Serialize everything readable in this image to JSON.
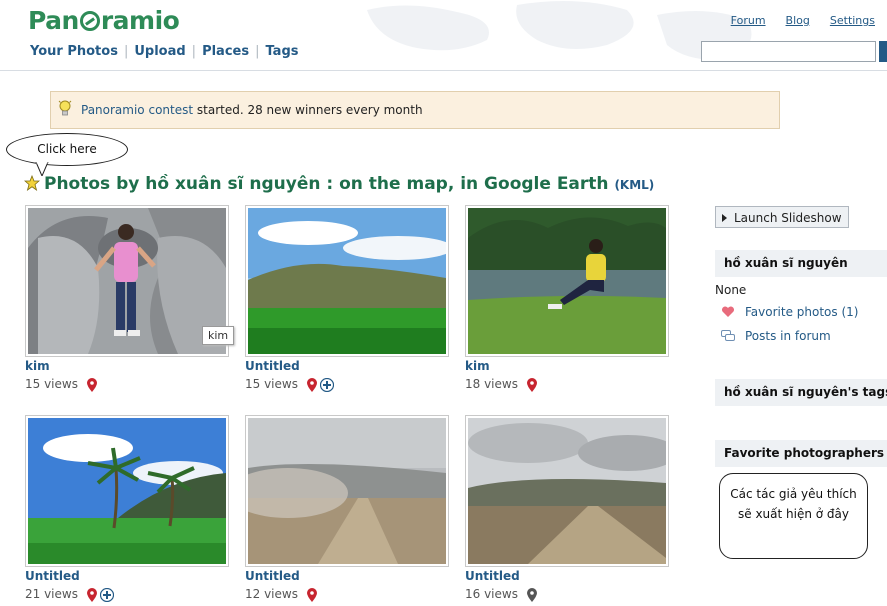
{
  "header": {
    "logo": "Panoramio",
    "nav": [
      "Your Photos",
      "Upload",
      "Places",
      "Tags"
    ],
    "top_links": [
      "Forum",
      "Blog",
      "Settings"
    ],
    "search_value": ""
  },
  "banner": {
    "link": "Panoramio contest",
    "text": " started. 28 new winners every month"
  },
  "callout": "Click here",
  "title": {
    "main": "Photos by hồ xuân sĩ nguyên : on the map, in Google Earth",
    "kml": "(KML)"
  },
  "photos": [
    {
      "title": "kim",
      "views": "15 views",
      "plus": false
    },
    {
      "title": "Untitled",
      "views": "15 views",
      "plus": true
    },
    {
      "title": "kim",
      "views": "18 views",
      "plus": false
    },
    {
      "title": "Untitled",
      "views": "21 views",
      "plus": true
    },
    {
      "title": "Untitled",
      "views": "12 views",
      "plus": false
    },
    {
      "title": "Untitled",
      "views": "16 views",
      "plus": false
    }
  ],
  "tooltip": "kim",
  "sidebar": {
    "slideshow": "Launch Slideshow",
    "user_head": "hồ xuân sĩ nguyên",
    "none": "None",
    "favorite_photos": "Favorite photos (1)",
    "posts_in_forum": "Posts in forum",
    "tags_head": "hồ xuân sĩ nguyên's tags",
    "fav_photographers_head": "Favorite photographers",
    "note_line1": "Các tác giả yêu thích",
    "note_line2": "sẽ xuất hiện ở đây"
  },
  "colors": {
    "brand_green": "#2e8b57",
    "link_blue": "#245a86",
    "banner_bg": "#fbf0df",
    "title_green": "#1e6e4b"
  }
}
